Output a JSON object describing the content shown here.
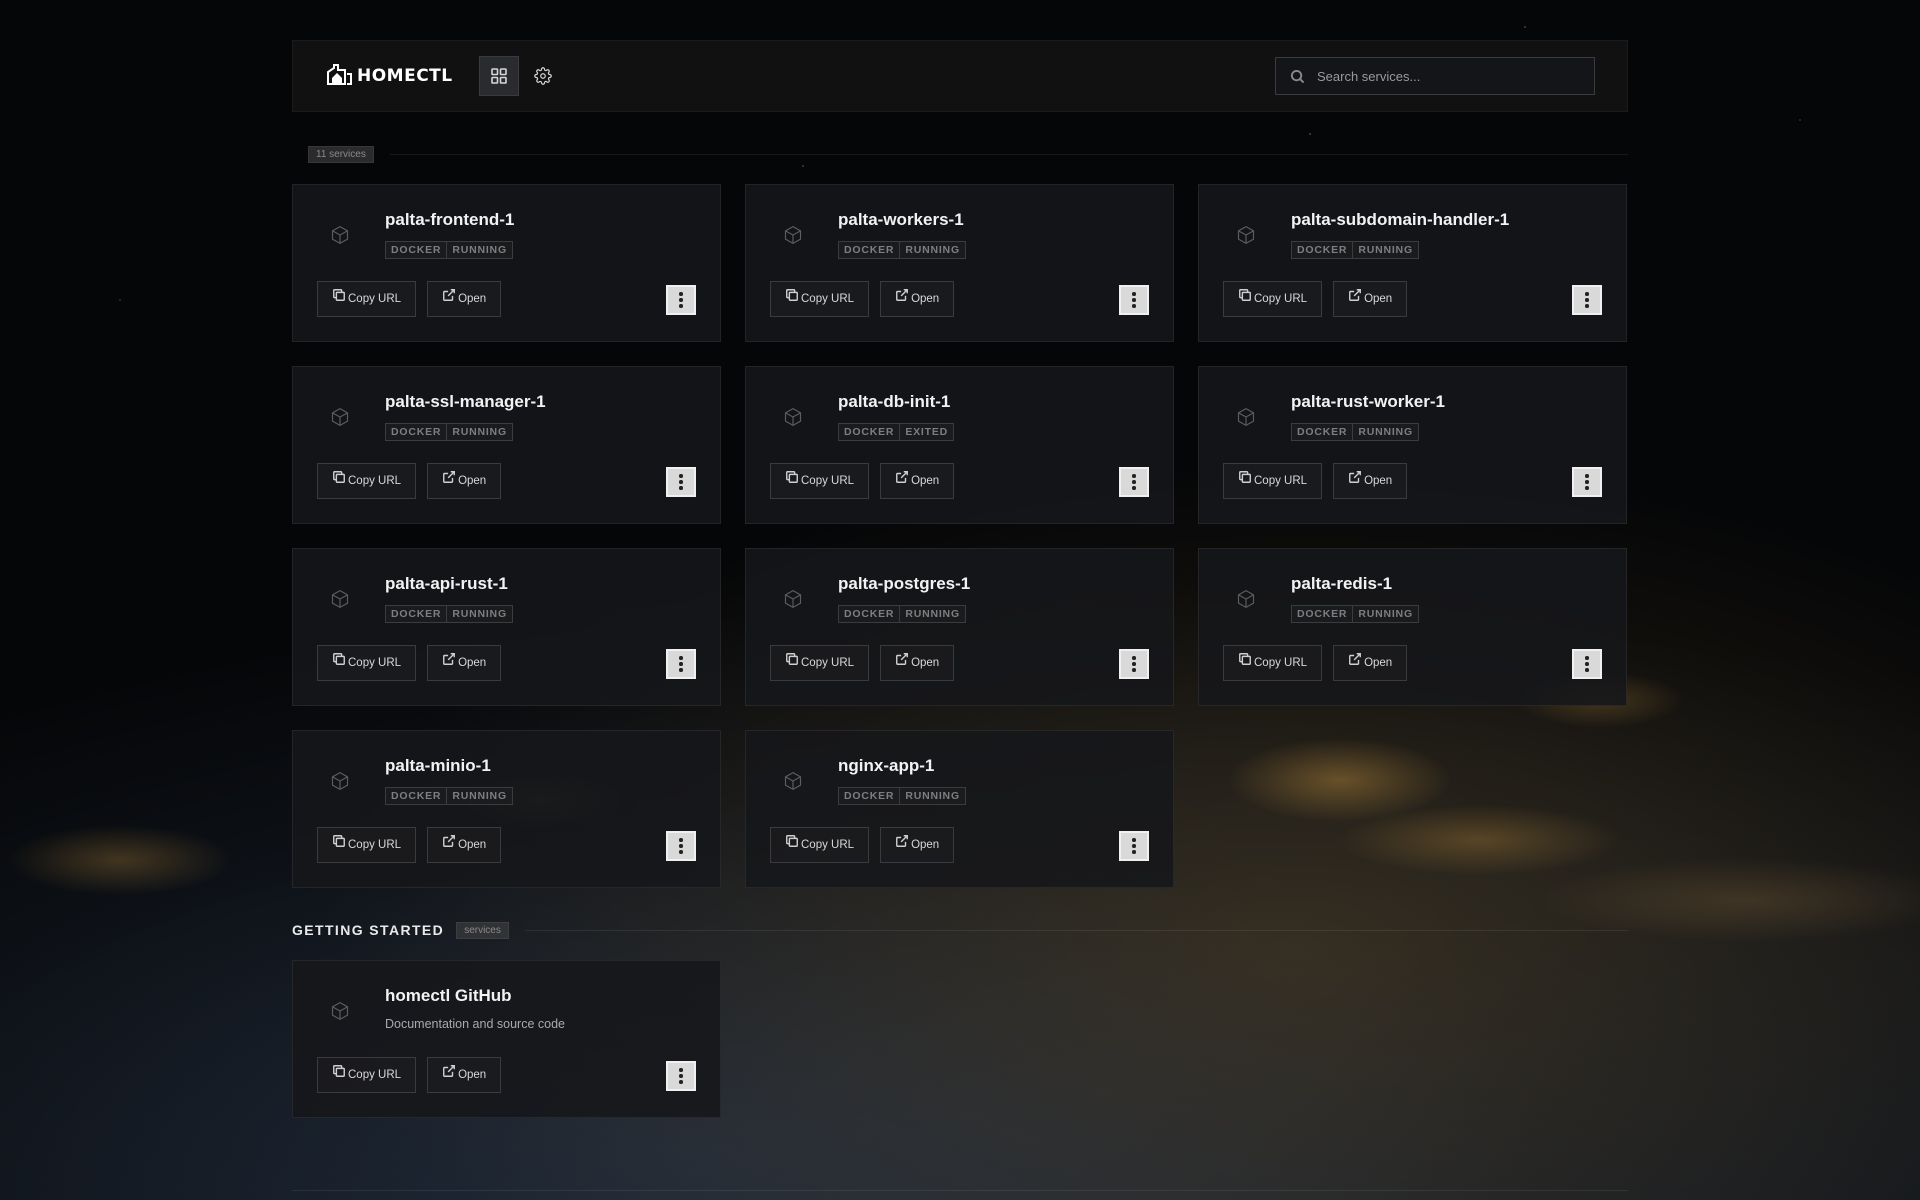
{
  "app": {
    "name": "HOMECTL"
  },
  "header": {
    "search_placeholder": "Search services..."
  },
  "sections": [
    {
      "title": "",
      "count_label": "11 services",
      "services": [
        {
          "name": "palta-frontend-1",
          "tags": [
            "DOCKER",
            "RUNNING"
          ]
        },
        {
          "name": "palta-workers-1",
          "tags": [
            "DOCKER",
            "RUNNING"
          ]
        },
        {
          "name": "palta-subdomain-handler-1",
          "tags": [
            "DOCKER",
            "RUNNING"
          ]
        },
        {
          "name": "palta-ssl-manager-1",
          "tags": [
            "DOCKER",
            "RUNNING"
          ]
        },
        {
          "name": "palta-db-init-1",
          "tags": [
            "DOCKER",
            "EXITED"
          ]
        },
        {
          "name": "palta-rust-worker-1",
          "tags": [
            "DOCKER",
            "RUNNING"
          ]
        },
        {
          "name": "palta-api-rust-1",
          "tags": [
            "DOCKER",
            "RUNNING"
          ]
        },
        {
          "name": "palta-postgres-1",
          "tags": [
            "DOCKER",
            "RUNNING"
          ]
        },
        {
          "name": "palta-redis-1",
          "tags": [
            "DOCKER",
            "RUNNING"
          ]
        },
        {
          "name": "palta-minio-1",
          "tags": [
            "DOCKER",
            "RUNNING"
          ]
        },
        {
          "name": "nginx-app-1",
          "tags": [
            "DOCKER",
            "RUNNING"
          ]
        }
      ]
    },
    {
      "title": "GETTING STARTED",
      "count_label": "services",
      "services": [
        {
          "name": "homectl GitHub",
          "description": "Documentation and source code"
        }
      ]
    }
  ],
  "actions": {
    "copy_url_label": "Copy URL",
    "open_label": "Open"
  },
  "icons": {
    "view_toggle": "grid-icon",
    "settings": "gear-icon",
    "search": "search-icon",
    "service": "cube-icon",
    "copy": "copy-icon",
    "open": "external-link-icon",
    "more": "more-vertical-icon"
  }
}
